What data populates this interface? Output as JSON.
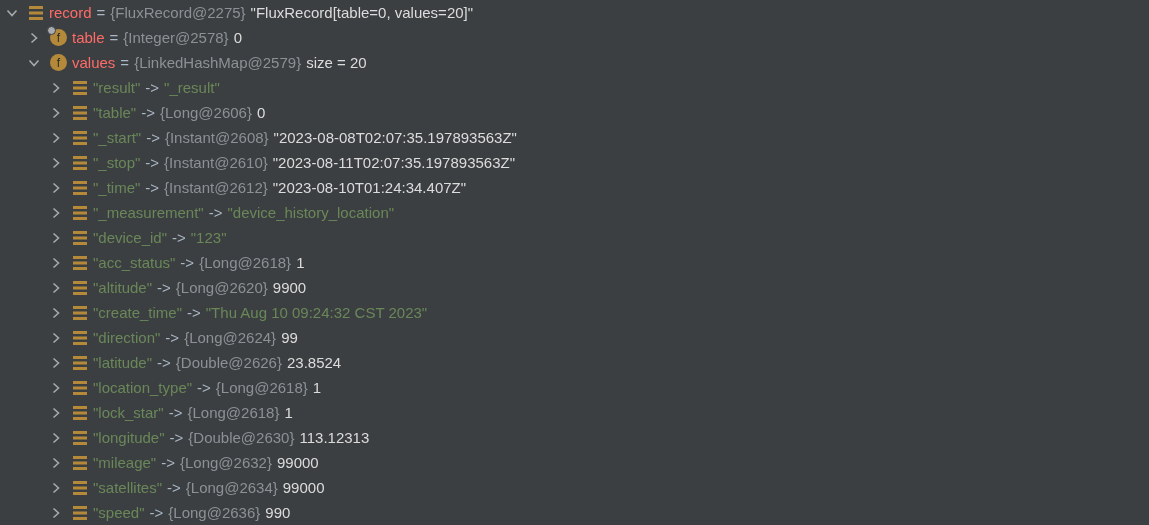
{
  "tree": [
    {
      "kind": "variable",
      "expanded": true,
      "name": "record",
      "operator": "=",
      "type": "{FluxRecord@2275}",
      "value": "\"FluxRecord[table=0, values=20]\"",
      "is_string": false,
      "children": [
        {
          "kind": "field",
          "badge": "f",
          "marked": true,
          "expanded": false,
          "name": "table",
          "operator": "=",
          "type": "{Integer@2578}",
          "value": "0",
          "is_string": false
        },
        {
          "kind": "field",
          "badge": "f",
          "marked": false,
          "expanded": true,
          "name": "values",
          "operator": "=",
          "type": "{LinkedHashMap@2579}",
          "value": "size = 20",
          "is_string": false,
          "children": [
            {
              "kind": "entry",
              "expanded": false,
              "name": "\"result\"",
              "operator": "->",
              "value": "\"_result\"",
              "is_string": true
            },
            {
              "kind": "entry",
              "expanded": false,
              "name": "\"table\"",
              "operator": "->",
              "type": "{Long@2606}",
              "value": "0",
              "is_string": false
            },
            {
              "kind": "entry",
              "expanded": false,
              "name": "\"_start\"",
              "operator": "->",
              "type": "{Instant@2608}",
              "value": "\"2023-08-08T02:07:35.197893563Z\"",
              "is_string": false
            },
            {
              "kind": "entry",
              "expanded": false,
              "name": "\"_stop\"",
              "operator": "->",
              "type": "{Instant@2610}",
              "value": "\"2023-08-11T02:07:35.197893563Z\"",
              "is_string": false
            },
            {
              "kind": "entry",
              "expanded": false,
              "name": "\"_time\"",
              "operator": "->",
              "type": "{Instant@2612}",
              "value": "\"2023-08-10T01:24:34.407Z\"",
              "is_string": false
            },
            {
              "kind": "entry",
              "expanded": false,
              "name": "\"_measurement\"",
              "operator": "->",
              "value": "\"device_history_location\"",
              "is_string": true
            },
            {
              "kind": "entry",
              "expanded": false,
              "name": "\"device_id\"",
              "operator": "->",
              "value": "\"123\"",
              "is_string": true
            },
            {
              "kind": "entry",
              "expanded": false,
              "name": "\"acc_status\"",
              "operator": "->",
              "type": "{Long@2618}",
              "value": "1",
              "is_string": false
            },
            {
              "kind": "entry",
              "expanded": false,
              "name": "\"altitude\"",
              "operator": "->",
              "type": "{Long@2620}",
              "value": "9900",
              "is_string": false
            },
            {
              "kind": "entry",
              "expanded": false,
              "name": "\"create_time\"",
              "operator": "->",
              "value": "\"Thu Aug 10 09:24:32 CST 2023\"",
              "is_string": true
            },
            {
              "kind": "entry",
              "expanded": false,
              "name": "\"direction\"",
              "operator": "->",
              "type": "{Long@2624}",
              "value": "99",
              "is_string": false
            },
            {
              "kind": "entry",
              "expanded": false,
              "name": "\"latitude\"",
              "operator": "->",
              "type": "{Double@2626}",
              "value": "23.8524",
              "is_string": false
            },
            {
              "kind": "entry",
              "expanded": false,
              "name": "\"location_type\"",
              "operator": "->",
              "type": "{Long@2618}",
              "value": "1",
              "is_string": false
            },
            {
              "kind": "entry",
              "expanded": false,
              "name": "\"lock_star\"",
              "operator": "->",
              "type": "{Long@2618}",
              "value": "1",
              "is_string": false
            },
            {
              "kind": "entry",
              "expanded": false,
              "name": "\"longitude\"",
              "operator": "->",
              "type": "{Double@2630}",
              "value": "113.12313",
              "is_string": false
            },
            {
              "kind": "entry",
              "expanded": false,
              "name": "\"mileage\"",
              "operator": "->",
              "type": "{Long@2632}",
              "value": "99000",
              "is_string": false
            },
            {
              "kind": "entry",
              "expanded": false,
              "name": "\"satellites\"",
              "operator": "->",
              "type": "{Long@2634}",
              "value": "99000",
              "is_string": false
            },
            {
              "kind": "entry",
              "expanded": false,
              "name": "\"speed\"",
              "operator": "->",
              "type": "{Long@2636}",
              "value": "990",
              "is_string": false
            }
          ]
        }
      ]
    }
  ]
}
